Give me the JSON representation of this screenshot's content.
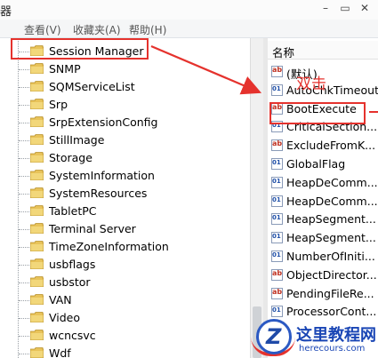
{
  "window": {
    "title_fragment": "器"
  },
  "menu": {
    "items": [
      "查看(V)",
      "收藏夹(A)",
      "帮助(H)"
    ]
  },
  "tree": {
    "items": [
      {
        "label": "Session Manager",
        "selected": true
      },
      {
        "label": "SNMP"
      },
      {
        "label": "SQMServiceList"
      },
      {
        "label": "Srp"
      },
      {
        "label": "SrpExtensionConfig"
      },
      {
        "label": "StillImage"
      },
      {
        "label": "Storage"
      },
      {
        "label": "SystemInformation"
      },
      {
        "label": "SystemResources"
      },
      {
        "label": "TabletPC"
      },
      {
        "label": "Terminal Server"
      },
      {
        "label": "TimeZoneInformation"
      },
      {
        "label": "usbflags"
      },
      {
        "label": "usbstor"
      },
      {
        "label": "VAN"
      },
      {
        "label": "Video"
      },
      {
        "label": "wcncsvc"
      },
      {
        "label": "Wdf"
      }
    ]
  },
  "values": {
    "column_header": "名称",
    "items": [
      {
        "label": "(默认)",
        "icon": "string-value-icon"
      },
      {
        "label": "AutoChkTimeout",
        "icon": "binary-value-icon"
      },
      {
        "label": "BootExecute",
        "icon": "string-value-icon"
      },
      {
        "label": "CriticalSection...",
        "icon": "binary-value-icon"
      },
      {
        "label": "ExcludeFromK...",
        "icon": "string-value-icon"
      },
      {
        "label": "GlobalFlag",
        "icon": "binary-value-icon"
      },
      {
        "label": "HeapDeComm...",
        "icon": "binary-value-icon"
      },
      {
        "label": "HeapDeComm...",
        "icon": "binary-value-icon"
      },
      {
        "label": "HeapSegment...",
        "icon": "binary-value-icon"
      },
      {
        "label": "HeapSegment...",
        "icon": "binary-value-icon"
      },
      {
        "label": "NumberOfIniti...",
        "icon": "binary-value-icon"
      },
      {
        "label": "ObjectDirector...",
        "icon": "string-value-icon"
      },
      {
        "label": "PendingFileRe...",
        "icon": "string-value-icon"
      },
      {
        "label": "ProcessorCont...",
        "icon": "binary-value-icon"
      }
    ]
  },
  "annotation": {
    "callout": "双击",
    "color": "#e5322d"
  },
  "watermark": {
    "cn": "这里教程网",
    "en": "herecours.com",
    "mark": "Z"
  }
}
